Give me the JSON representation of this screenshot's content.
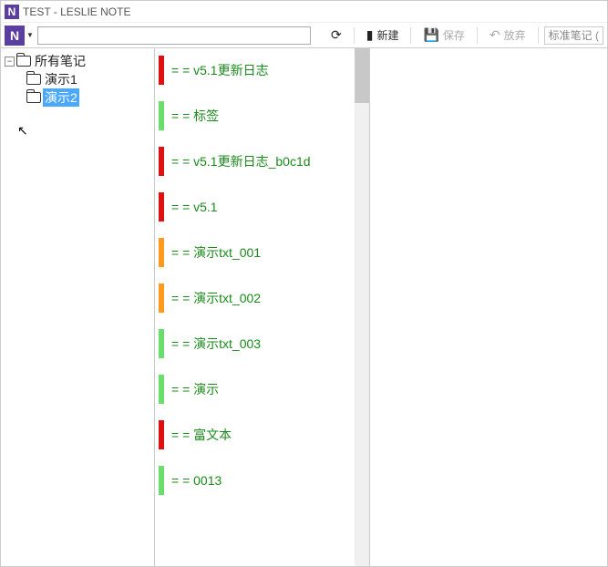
{
  "window": {
    "title": "TEST - LESLIE NOTE"
  },
  "toolbar": {
    "refresh_title": "刷新",
    "new_label": "新建",
    "save_label": "保存",
    "discard_label": "放弃",
    "note_type_placeholder": "标准笔记 ("
  },
  "tree": {
    "root": {
      "label": "所有笔记"
    },
    "children": [
      {
        "label": "演示1",
        "selected": false
      },
      {
        "label": "演示2",
        "selected": true
      }
    ]
  },
  "list": {
    "items": [
      {
        "prefix": "= =",
        "title": "v5.1更新日志",
        "color": "#d11"
      },
      {
        "prefix": "= =",
        "title": "标签",
        "color": "#6ade6a"
      },
      {
        "prefix": "= =",
        "title": "v5.1更新日志_b0c1d",
        "color": "#d11"
      },
      {
        "prefix": "= =",
        "title": "v5.1",
        "color": "#d11"
      },
      {
        "prefix": "= =",
        "title": "演示txt_001",
        "color": "#ff9a1f"
      },
      {
        "prefix": "= =",
        "title": "演示txt_002",
        "color": "#ff9a1f"
      },
      {
        "prefix": "= =",
        "title": "演示txt_003",
        "color": "#6ade6a"
      },
      {
        "prefix": "= =",
        "title": "演示",
        "color": "#6ade6a"
      },
      {
        "prefix": "= =",
        "title": "富文本",
        "color": "#d11"
      },
      {
        "prefix": "= =",
        "title": "0013",
        "color": "#6ade6a"
      }
    ]
  }
}
